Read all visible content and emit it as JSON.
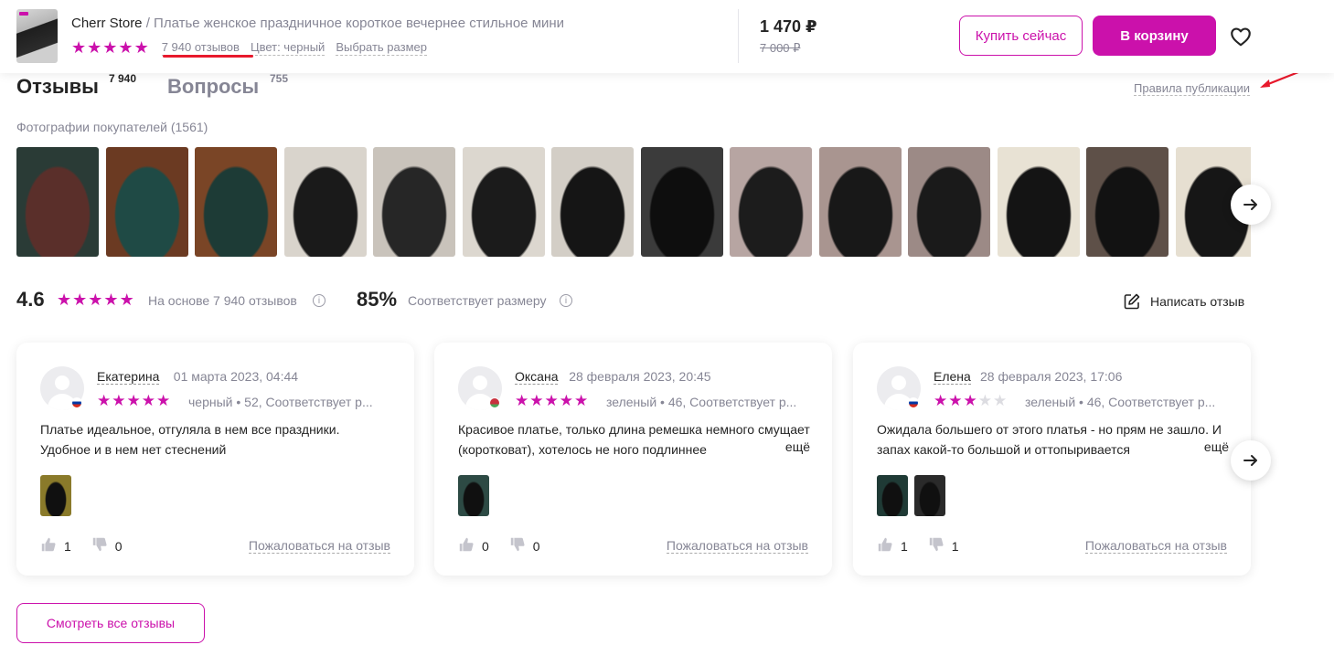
{
  "header": {
    "store": "Cherr Store",
    "separator": " / ",
    "product_title": "Платье женское праздничное короткое вечернее стильное мини",
    "rating_stars": 5,
    "reviews_link": "7 940 отзывов",
    "color_link": "Цвет: черный",
    "size_link": "Выбрать размер",
    "price": "1 470 ₽",
    "old_price": "7 000 ₽",
    "buy_now": "Купить сейчас",
    "add_to_cart": "В корзину",
    "favorite_icon": "heart-icon"
  },
  "tabs": [
    {
      "label": "Отзывы",
      "count": "7 940",
      "active": true
    },
    {
      "label": "Вопросы",
      "count": "755",
      "active": false
    }
  ],
  "rules_link": "Правила публикации",
  "photos": {
    "label": "Фотографии покупателей (1561)",
    "next_icon": "arrow-right-icon",
    "items": [
      {
        "bg": "#2a3b36",
        "accent": "#5a2f2a"
      },
      {
        "bg": "#6b3a22",
        "accent": "#1f4a45"
      },
      {
        "bg": "#7a4526",
        "accent": "#1d3b36"
      },
      {
        "bg": "#d9d4cc",
        "accent": "#1a1a1a"
      },
      {
        "bg": "#c9c3bb",
        "accent": "#262626"
      },
      {
        "bg": "#dcd7cf",
        "accent": "#1b1b1b"
      },
      {
        "bg": "#d3cec6",
        "accent": "#151515"
      },
      {
        "bg": "#3b3b3b",
        "accent": "#0e0e0e"
      },
      {
        "bg": "#b7a5a2",
        "accent": "#1c1c1c"
      },
      {
        "bg": "#a99590",
        "accent": "#181818"
      },
      {
        "bg": "#9c8a86",
        "accent": "#1a1a1a"
      },
      {
        "bg": "#e8e2d4",
        "accent": "#141414"
      },
      {
        "bg": "#5e5048",
        "accent": "#121212"
      },
      {
        "bg": "#e6dfd1",
        "accent": "#161616"
      }
    ]
  },
  "summary": {
    "rating": "4.6",
    "stars": 5,
    "based_on": "На основе 7 940 отзывов",
    "fit_percent": "85%",
    "fit_text": "Соответствует размеру",
    "write_review": "Написать отзыв",
    "info_icon": "info-icon",
    "edit_icon": "edit-icon"
  },
  "reviews": [
    {
      "name": "Екатерина",
      "date": "01 марта 2023, 04:44",
      "stars": 5,
      "meta": "черный • 52, Соответствует р...",
      "text": "Платье идеальное, отгуляла в нем все праздники. Удобное и в нем нет стеснений",
      "more": "",
      "flag": "ru",
      "photos": [
        "#8a7a2a"
      ],
      "likes": "1",
      "dislikes": "0",
      "complain": "Пожаловаться на отзыв"
    },
    {
      "name": "Оксана",
      "date": "28 февраля 2023, 20:45",
      "stars": 5,
      "meta": "зеленый • 46, Соответствует р...",
      "text": "Красивое платье, только длина ремешка немного смущает (коротковат), хотелось не ного подлиннее",
      "more": "ещё",
      "flag": "by",
      "photos": [
        "#2d4a44"
      ],
      "likes": "0",
      "dislikes": "0",
      "complain": "Пожаловаться на отзыв"
    },
    {
      "name": "Елена",
      "date": "28 февраля 2023, 17:06",
      "stars": 3,
      "meta": "зеленый • 46, Соответствует р...",
      "text": "Ожидала большего от этого платья - но прям не зашло. И запах какой-то большой и оттопыривается",
      "more": "ещё",
      "flag": "ru",
      "photos": [
        "#1f3a35",
        "#2a2a2a"
      ],
      "likes": "1",
      "dislikes": "1",
      "complain": "Пожаловаться на отзыв"
    }
  ],
  "show_all": "Смотреть все отзывы",
  "colors": {
    "accent": "#cb11ab",
    "muted": "#868695",
    "annotation": "#e8192c"
  }
}
